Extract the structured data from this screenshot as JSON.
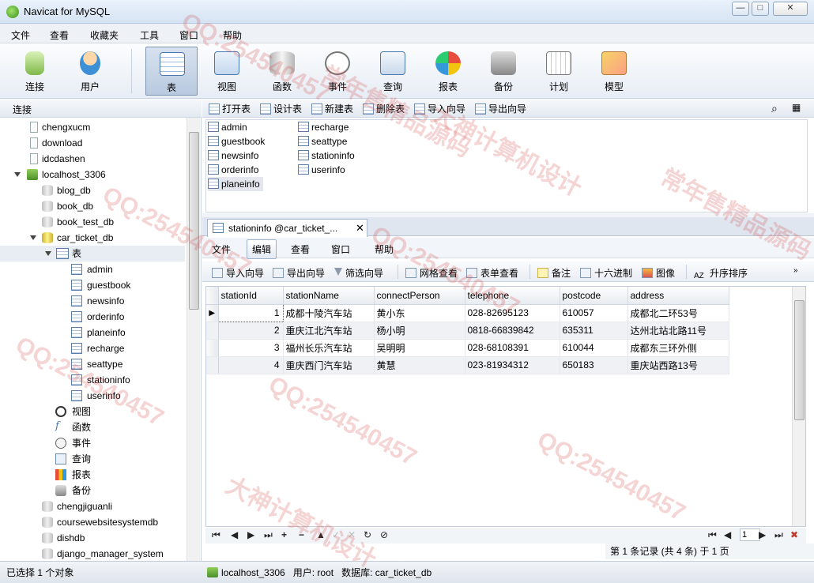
{
  "app": {
    "title": "Navicat for MySQL"
  },
  "window_controls": {
    "minimize": "—",
    "maximize": "□",
    "close": "✕"
  },
  "menu": [
    "文件",
    "查看",
    "收藏夹",
    "工具",
    "窗口",
    "帮助"
  ],
  "toolbar": [
    {
      "label": "连接",
      "icon": "plug-icon"
    },
    {
      "label": "用户",
      "icon": "user-icon"
    },
    {
      "label": "表",
      "icon": "table-icon",
      "active": true
    },
    {
      "label": "视图",
      "icon": "view-icon"
    },
    {
      "label": "函数",
      "icon": "function-icon"
    },
    {
      "label": "事件",
      "icon": "event-icon"
    },
    {
      "label": "查询",
      "icon": "query-icon"
    },
    {
      "label": "报表",
      "icon": "report-icon"
    },
    {
      "label": "备份",
      "icon": "backup-icon"
    },
    {
      "label": "计划",
      "icon": "schedule-icon"
    },
    {
      "label": "模型",
      "icon": "model-icon"
    }
  ],
  "connections_header": "连接",
  "tree": {
    "items": [
      {
        "label": "chengxucm",
        "kind": "doc"
      },
      {
        "label": "download",
        "kind": "doc"
      },
      {
        "label": "idcdashen",
        "kind": "doc"
      },
      {
        "label": "localhost_3306",
        "kind": "host"
      },
      {
        "label": "blog_db",
        "kind": "db"
      },
      {
        "label": "book_db",
        "kind": "db"
      },
      {
        "label": "book_test_db",
        "kind": "db"
      },
      {
        "label": "car_ticket_db",
        "kind": "db-open"
      },
      {
        "label": "表",
        "kind": "tables-folder"
      },
      {
        "label": "admin",
        "kind": "table"
      },
      {
        "label": "guestbook",
        "kind": "table"
      },
      {
        "label": "newsinfo",
        "kind": "table"
      },
      {
        "label": "orderinfo",
        "kind": "table"
      },
      {
        "label": "planeinfo",
        "kind": "table"
      },
      {
        "label": "recharge",
        "kind": "table"
      },
      {
        "label": "seattype",
        "kind": "table"
      },
      {
        "label": "stationinfo",
        "kind": "table"
      },
      {
        "label": "userinfo",
        "kind": "table"
      },
      {
        "label": "视图",
        "kind": "views"
      },
      {
        "label": "函数",
        "kind": "functions"
      },
      {
        "label": "事件",
        "kind": "events"
      },
      {
        "label": "查询",
        "kind": "queries"
      },
      {
        "label": "报表",
        "kind": "reports"
      },
      {
        "label": "备份",
        "kind": "backups"
      },
      {
        "label": "chengjiguanli",
        "kind": "db"
      },
      {
        "label": "coursewebsitesystemdb",
        "kind": "db"
      },
      {
        "label": "dishdb",
        "kind": "db"
      },
      {
        "label": "django_manager_system",
        "kind": "db"
      }
    ]
  },
  "object_toolbar": [
    "打开表",
    "设计表",
    "新建表",
    "删除表",
    "导入向导",
    "导出向导"
  ],
  "object_list": {
    "col1": [
      "admin",
      "guestbook",
      "newsinfo",
      "orderinfo",
      "planeinfo"
    ],
    "col2": [
      "recharge",
      "seattype",
      "stationinfo",
      "userinfo"
    ],
    "selected": "planeinfo"
  },
  "tab": {
    "title": "stationinfo @car_ticket_...",
    "close": "✕"
  },
  "inner_menu": [
    "文件",
    "编辑",
    "查看",
    "窗口",
    "帮助"
  ],
  "grid_toolbar": [
    "导入向导",
    "导出向导",
    "筛选向导",
    "网格查看",
    "表单查看",
    "备注",
    "十六进制",
    "图像",
    "升序排序"
  ],
  "grid": {
    "columns": [
      "stationId",
      "stationName",
      "connectPerson",
      "telephone",
      "postcode",
      "address"
    ],
    "rows": [
      [
        "1",
        "成都十陵汽车站",
        "黄小东",
        "028-82695123",
        "610057",
        "成都北二环53号"
      ],
      [
        "2",
        "重庆江北汽车站",
        "杨小明",
        "0818-66839842",
        "635311",
        "达州北站北路11号"
      ],
      [
        "3",
        "福州长乐汽车站",
        "吴明明",
        "028-68108391",
        "610044",
        "成都东三环外侧"
      ],
      [
        "4",
        "重庆西门汽车站",
        "黄慧",
        "023-81934312",
        "650183",
        "重庆站西路13号"
      ]
    ]
  },
  "nav": {
    "page": "1",
    "record_status": "第 1 条记录 (共 4 条) 于 1 页"
  },
  "status": {
    "left": "已选择 1 个对象",
    "host": "localhost_3306",
    "user": "用户: root",
    "database": "数据库: car_ticket_db"
  },
  "watermarks": [
    "QQ:254540457",
    "大神计算机设计",
    "常年售精品源码"
  ]
}
